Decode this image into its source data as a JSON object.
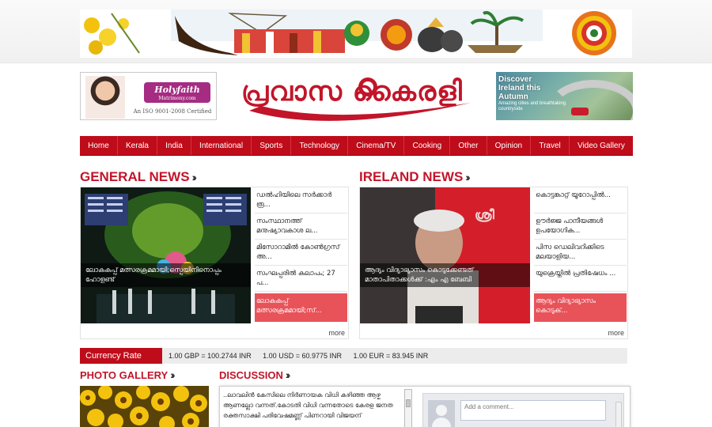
{
  "banner": {
    "alt": "Kerala festival banner"
  },
  "ads": {
    "left": {
      "brand": "Holyfaith",
      "brand_sub": "Matrimony.com",
      "iso": "An ISO 9001-2008 Certified"
    },
    "right": {
      "headline_lines": [
        "Discover",
        "Ireland this",
        "Autumn"
      ],
      "sub": "Amazing cities and breathtaking countryside"
    }
  },
  "logo": {
    "text": "പ്രവാസ കൈരളി"
  },
  "nav": {
    "items": [
      "Home",
      "Kerala",
      "India",
      "International",
      "Sports",
      "Technology",
      "Cinema/TV",
      "Cooking",
      "Other",
      "Opinion",
      "Travel",
      "Video Gallery"
    ]
  },
  "general_news": {
    "title": "GENERAL NEWS",
    "caption": "ലോകകപ്പ് മത്സരക്രമമായി;സ്പെയിനിനൊപ്പം ഹോളണ്ട്",
    "items": [
      "ഡൽഹിയിലെ സർക്കാർ രൂ...",
      "സംസ്ഥാനത്ത് മനുഷ്യാവകാശ ല...",
      "മിസോറാമിൽ കോൺഗ്രസ് അ...",
      "സംഘപ്പരിൽ കലാപം; 27 പ...",
      "ലോകകപ്പ് മത്സരക്രമമായി;സ്..."
    ],
    "more": "more"
  },
  "ireland_news": {
    "title": "IRELAND NEWS",
    "caption": "ആദ്യം വിദ്യാഭ്യാസം കൊടുക്കേണ്ടത് മാതാപിതാക്കൾക്ക് :എം എ ബേബി",
    "items": [
      "കൊട്ടങ്കാറ്റ് യൂറോപ്പിൽ...",
      "ഊർജ്ജ പാനീയങ്ങൾ ഉപയോഗിക...",
      "പിസ ഡെലിവറിക്കിടെ മലയാളിയ...",
      "യുക്രെയ്നിൽ പ്രതിഷേധം ...",
      "ആദ്യം വിദ്യാഭ്യാസം കൊടുക്..."
    ],
    "more": "more"
  },
  "currency": {
    "label": "Currency Rate",
    "rates": [
      "1.00 GBP = 100.2744 INR",
      "1.00 USD = 60.9775 INR",
      "1.00 EUR = 83.945 INR"
    ]
  },
  "photo_gallery": {
    "title": "PHOTO GALLERY"
  },
  "discussion": {
    "title": "DISCUSSION",
    "text": "..ലാവലിൻ കേസിലെ നിർണായക വിധി കഴിഞ്ഞ ആഴ്ച ആണല്ലോ വന്നത്.കോടതി വിധി വന്നതോടെ കേരള ജനത രക്തസാക്ഷി പരിവേഷമണ്ണ് പിണറായി വിജയന്",
    "comment_placeholder": "Add a comment..."
  },
  "colors": {
    "brand_red": "#bf0c1a",
    "accent_pink": "#e8535a",
    "title_red": "#c2152a"
  }
}
